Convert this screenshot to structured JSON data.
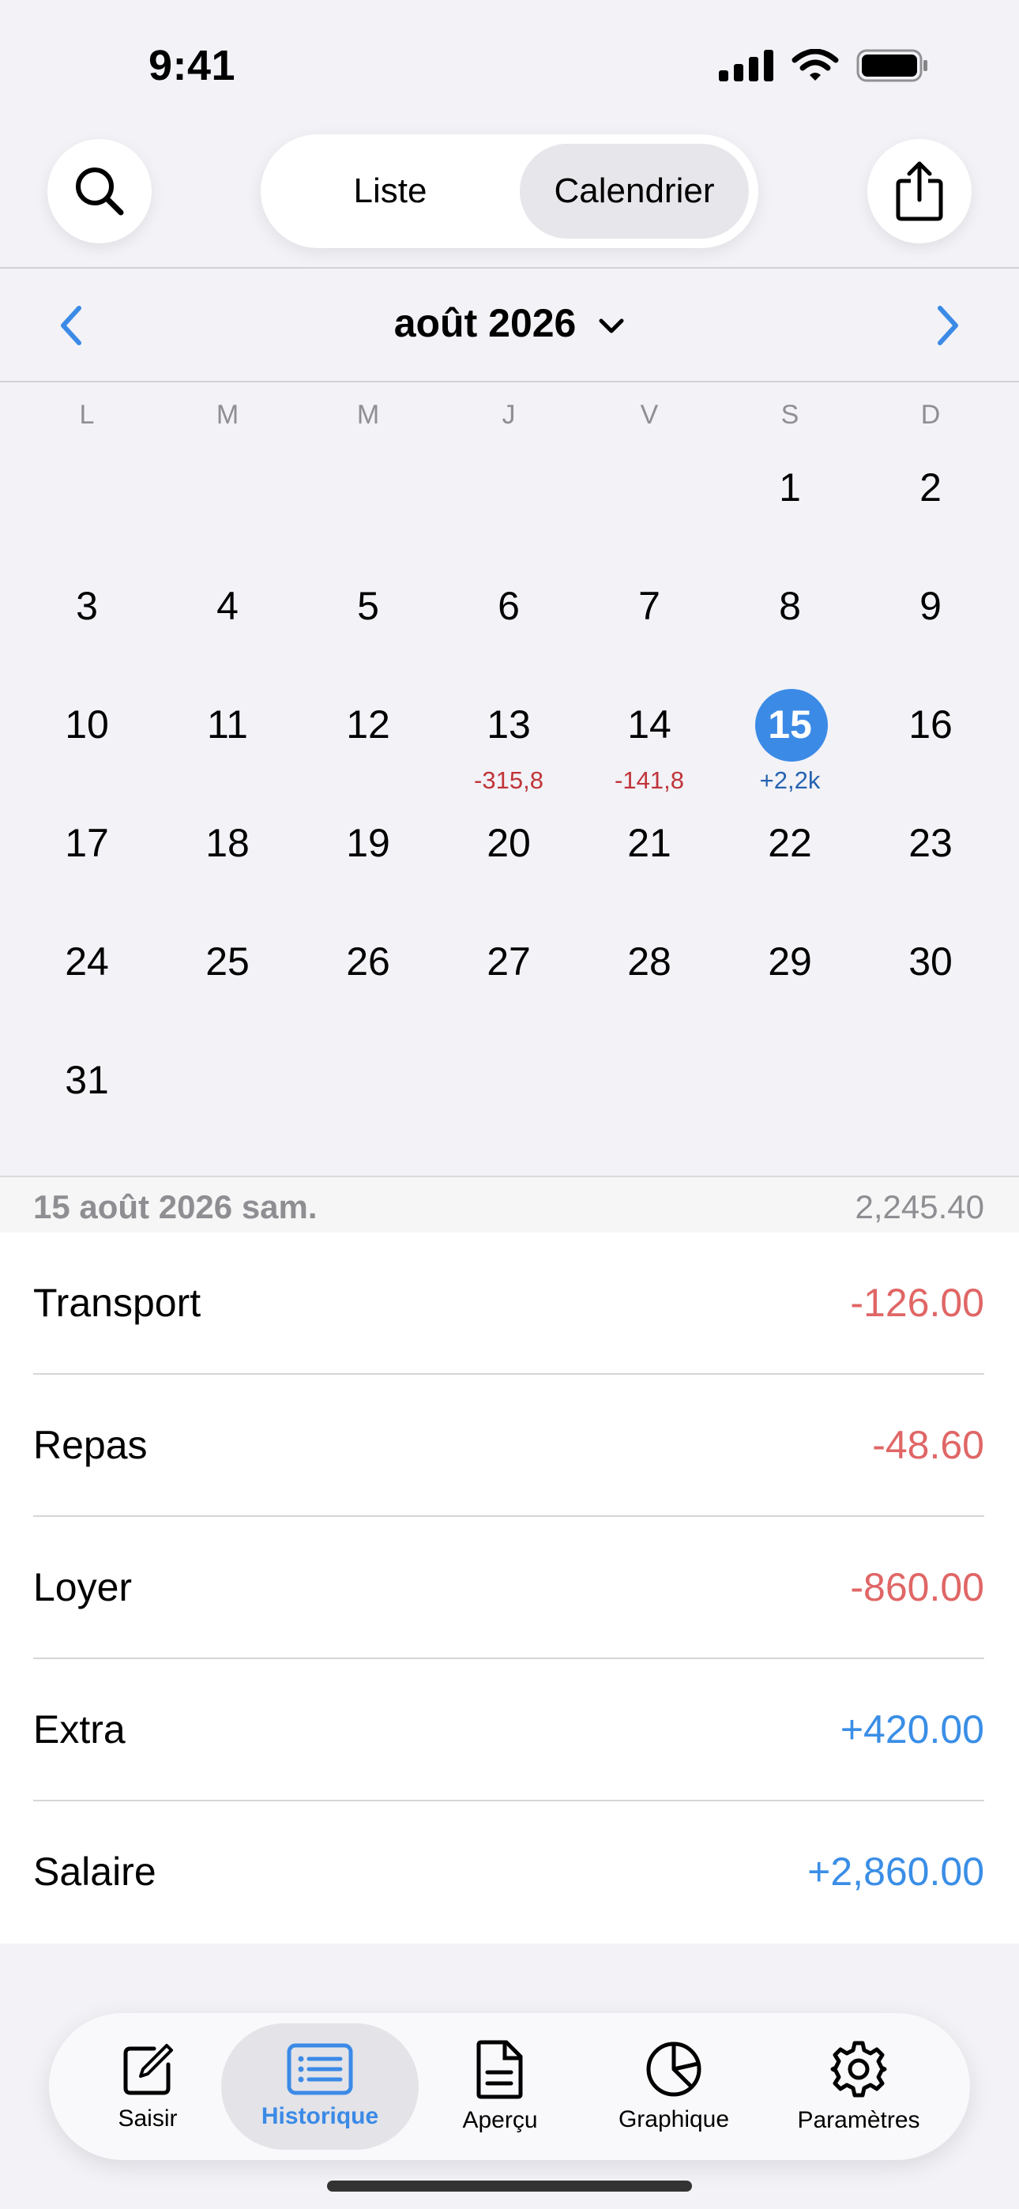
{
  "status_bar": {
    "time": "9:41"
  },
  "header": {
    "segments": [
      {
        "label": "Liste"
      },
      {
        "label": "Calendrier"
      }
    ],
    "selected_segment": "Calendrier"
  },
  "calendar": {
    "month_title": "août 2026",
    "weekdays": [
      "L",
      "M",
      "M",
      "J",
      "V",
      "S",
      "D"
    ],
    "days": [
      "1",
      "2",
      "3",
      "4",
      "5",
      "6",
      "7",
      "8",
      "9",
      "10",
      "11",
      "12",
      "13",
      "14",
      "15",
      "16",
      "17",
      "18",
      "19",
      "20",
      "21",
      "22",
      "23",
      "24",
      "25",
      "26",
      "27",
      "28",
      "29",
      "30",
      "31"
    ],
    "selected_day": "15",
    "day_amounts": [
      {
        "day": "13",
        "amount": "-315,8"
      },
      {
        "day": "14",
        "amount": "-141,8"
      },
      {
        "day": "15",
        "amount": "+2,2k"
      }
    ]
  },
  "day_detail": {
    "date": "15 août 2026 sam.",
    "total": "2,245.40",
    "transactions": [
      {
        "name": "Transport",
        "amount": "-126.00"
      },
      {
        "name": "Repas",
        "amount": "-48.60"
      },
      {
        "name": "Loyer",
        "amount": "-860.00"
      },
      {
        "name": "Extra",
        "amount": "+420.00"
      },
      {
        "name": "Salaire",
        "amount": "+2,860.00"
      }
    ]
  },
  "tabbar": {
    "tabs": [
      {
        "label": "Saisir",
        "icon": "compose-icon"
      },
      {
        "label": "Historique",
        "icon": "list-icon"
      },
      {
        "label": "Aperçu",
        "icon": "document-icon"
      },
      {
        "label": "Graphique",
        "icon": "pie-chart-icon"
      },
      {
        "label": "Paramètres",
        "icon": "gear-icon"
      }
    ],
    "active": "Historique"
  },
  "colors": {
    "accent": "#3b8ae6",
    "negative": "#e06666",
    "positive": "#3a8ee6"
  }
}
